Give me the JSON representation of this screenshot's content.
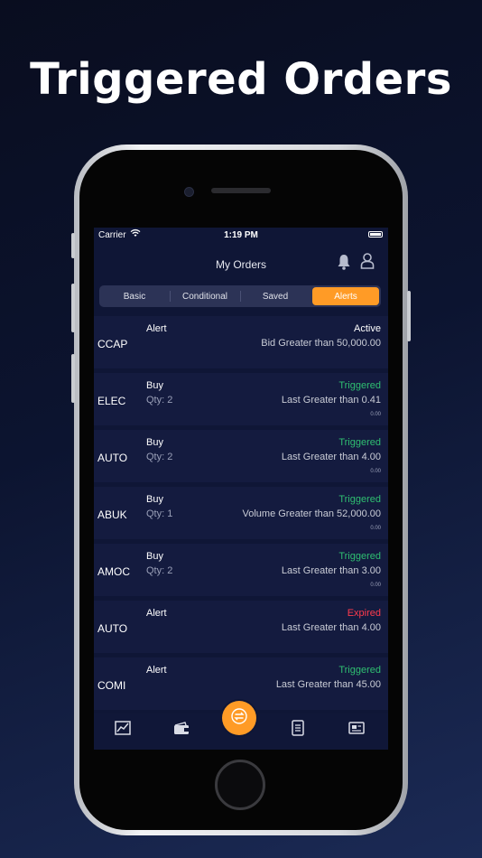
{
  "headline": "Triggered Orders",
  "status_bar": {
    "carrier": "Carrier",
    "time": "1:19 PM"
  },
  "nav": {
    "title": "My Orders"
  },
  "segments": [
    {
      "label": "Basic"
    },
    {
      "label": "Conditional"
    },
    {
      "label": "Saved"
    },
    {
      "label": "Alerts",
      "selected": true
    }
  ],
  "orders": [
    {
      "symbol": "CCAP",
      "type": "Alert",
      "qty": "",
      "state": "Active",
      "condition": "Bid Greater than 50,000.00",
      "change": ""
    },
    {
      "symbol": "ELEC",
      "type": "Buy",
      "qty": "Qty: 2",
      "state": "Triggered",
      "condition": "Last Greater than 0.41",
      "change": "0.00"
    },
    {
      "symbol": "AUTO",
      "type": "Buy",
      "qty": "Qty: 2",
      "state": "Triggered",
      "condition": "Last Greater than 4.00",
      "change": "0.00"
    },
    {
      "symbol": "ABUK",
      "type": "Buy",
      "qty": "Qty: 1",
      "state": "Triggered",
      "condition": "Volume Greater than 52,000.00",
      "change": "0.00"
    },
    {
      "symbol": "AMOC",
      "type": "Buy",
      "qty": "Qty: 2",
      "state": "Triggered",
      "condition": "Last Greater than 3.00",
      "change": "0.00"
    },
    {
      "symbol": "AUTO",
      "type": "Alert",
      "qty": "",
      "state": "Expired",
      "condition": "Last Greater than 4.00",
      "change": ""
    },
    {
      "symbol": "COMI",
      "type": "Alert",
      "qty": "",
      "state": "Triggered",
      "condition": "Last Greater than 45.00",
      "change": ""
    }
  ],
  "state_colors": {
    "Active": "#ffffff",
    "Triggered": "#2fbf71",
    "Expired": "#ff3b4d"
  },
  "accent_color": "#ff9b26",
  "tabs": [
    {
      "icon": "chart-icon"
    },
    {
      "icon": "wallet-icon"
    },
    {
      "icon": "trade-icon"
    },
    {
      "icon": "orders-icon",
      "selected": true
    },
    {
      "icon": "news-icon"
    }
  ]
}
